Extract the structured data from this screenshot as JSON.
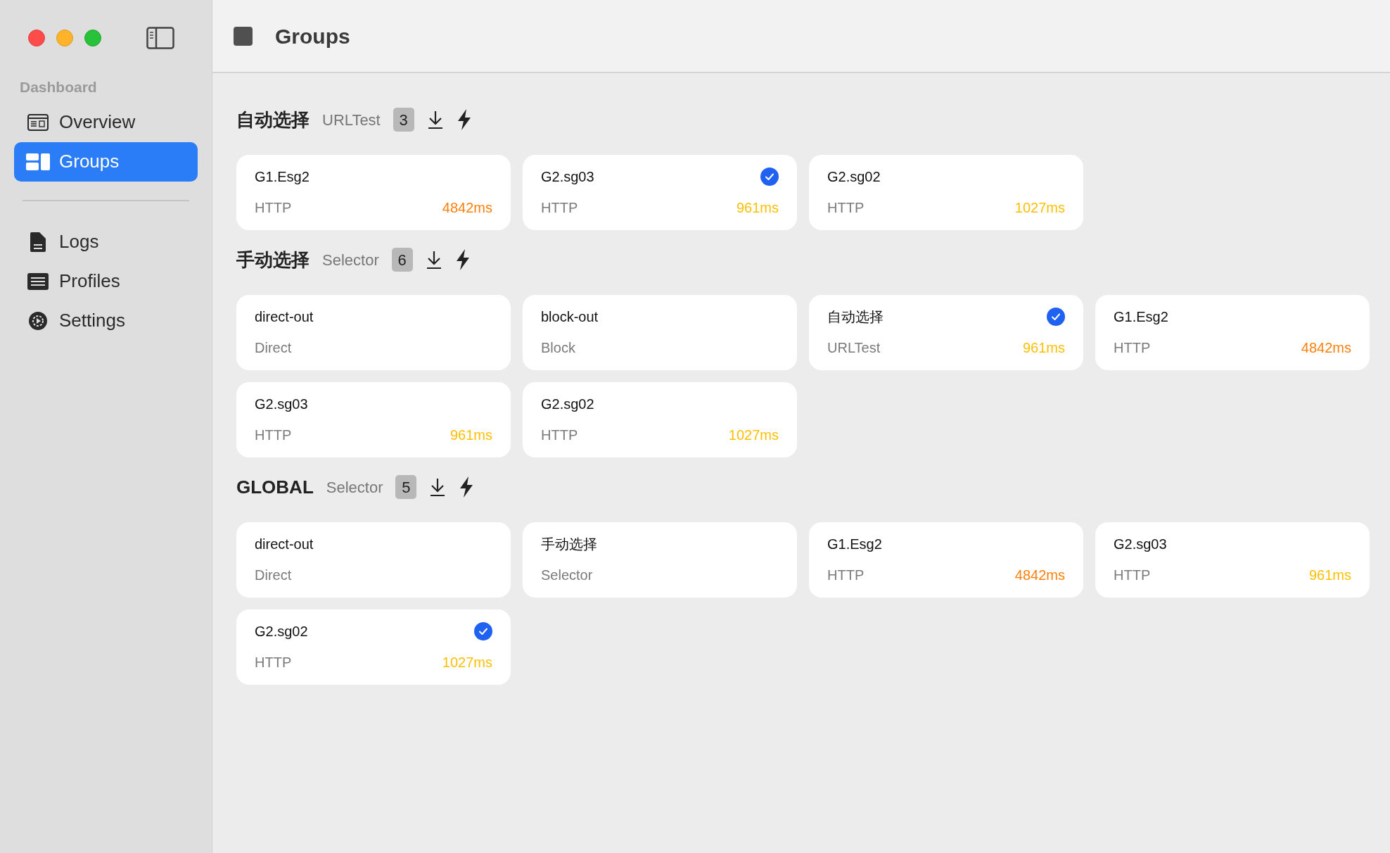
{
  "sidebar": {
    "section_title": "Dashboard",
    "items": [
      {
        "label": "Overview",
        "kind": "overview",
        "selected": false
      },
      {
        "label": "Groups",
        "kind": "groups",
        "selected": true
      }
    ],
    "bottom_items": [
      {
        "label": "Logs",
        "kind": "logs",
        "selected": false
      },
      {
        "label": "Profiles",
        "kind": "profiles",
        "selected": false
      },
      {
        "label": "Settings",
        "kind": "settings",
        "selected": false
      }
    ]
  },
  "header": {
    "title": "Groups"
  },
  "groups": [
    {
      "name": "自动选择",
      "type": "URLTest",
      "count": "3",
      "outbounds": [
        {
          "name": "G1.Esg2",
          "type": "HTTP",
          "delay": "4842ms",
          "color": "#ff7f0a",
          "selected": false
        },
        {
          "name": "G2.sg03",
          "type": "HTTP",
          "delay": "961ms",
          "color": "#fdbf00",
          "selected": true
        },
        {
          "name": "G2.sg02",
          "type": "HTTP",
          "delay": "1027ms",
          "color": "#fdbf00",
          "selected": false
        }
      ]
    },
    {
      "name": "手动选择",
      "type": "Selector",
      "count": "6",
      "outbounds": [
        {
          "name": "direct-out",
          "type": "Direct",
          "selected": false
        },
        {
          "name": "block-out",
          "type": "Block",
          "selected": false
        },
        {
          "name": "自动选择",
          "type": "URLTest",
          "delay": "961ms",
          "color": "#fdbf00",
          "selected": true
        },
        {
          "name": "G1.Esg2",
          "type": "HTTP",
          "delay": "4842ms",
          "color": "#ff7f0a",
          "selected": false
        },
        {
          "name": "G2.sg03",
          "type": "HTTP",
          "delay": "961ms",
          "color": "#fdbf00",
          "selected": false
        },
        {
          "name": "G2.sg02",
          "type": "HTTP",
          "delay": "1027ms",
          "color": "#fdbf00",
          "selected": false
        }
      ]
    },
    {
      "name": "GLOBAL",
      "type": "Selector",
      "count": "5",
      "outbounds": [
        {
          "name": "direct-out",
          "type": "Direct",
          "selected": false
        },
        {
          "name": "手动选择",
          "type": "Selector",
          "selected": false
        },
        {
          "name": "G1.Esg2",
          "type": "HTTP",
          "delay": "4842ms",
          "color": "#ff7f0a",
          "selected": false
        },
        {
          "name": "G2.sg03",
          "type": "HTTP",
          "delay": "961ms",
          "color": "#fdbf00",
          "selected": false
        },
        {
          "name": "G2.sg02",
          "type": "HTTP",
          "delay": "1027ms",
          "color": "#fdbf00",
          "selected": true
        }
      ]
    }
  ]
}
